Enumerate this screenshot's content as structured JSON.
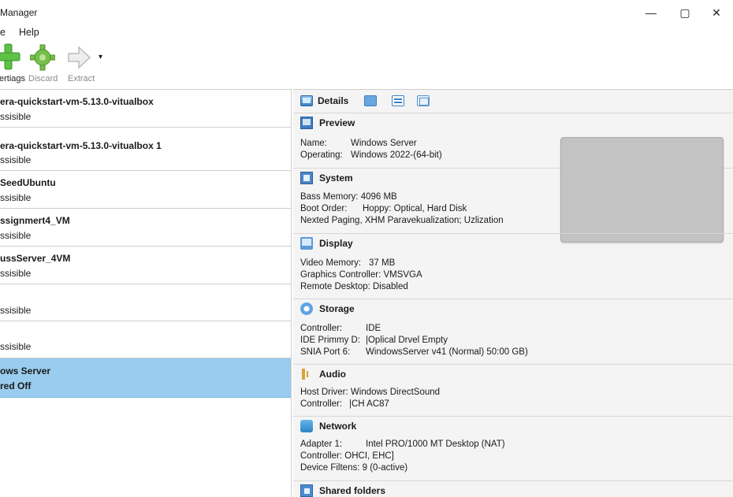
{
  "window": {
    "title": "Manager",
    "controls": {
      "minimize": "—",
      "maximize": "▢",
      "close": "✕"
    }
  },
  "menu": {
    "items": [
      "e",
      "Help"
    ]
  },
  "toolbar": {
    "buttons": [
      {
        "label": "ertiags",
        "icon": "new-icon"
      },
      {
        "label": "Discard",
        "icon": "discard-icon"
      },
      {
        "label": "Extract",
        "icon": "extract-icon"
      }
    ],
    "dropdown_glyph": "▾"
  },
  "vm_list": [
    {
      "name": "era-quickstart-vm-5.13.0-vitualbox",
      "state": "ssisible"
    },
    {
      "name": "era-quickstart-vm-5.13.0-vitualbox 1",
      "state": "ssisible"
    },
    {
      "name": "SeedUbuntu",
      "state": "ssisible"
    },
    {
      "name": "ssignmert4_VM",
      "state": "ssisible"
    },
    {
      "name": "ussServer_4VM",
      "state": "ssisible"
    },
    {
      "name": "",
      "state": "ssisible"
    },
    {
      "name": "",
      "state": "ssisible"
    },
    {
      "name": "ows Server",
      "state": "red Off",
      "selected": true
    }
  ],
  "details": {
    "tab_label": "Details",
    "sections": {
      "preview": {
        "title": "Preview",
        "rows": [
          {
            "k": "Name:",
            "v": "Windows Server"
          },
          {
            "k": "Operating:",
            "v": "Windows 2022-(64-bit)"
          }
        ]
      },
      "system": {
        "title": "System",
        "rows": [
          {
            "k": "Bass Memory:",
            "v": "4096 MB"
          },
          {
            "k": "Boot Order:",
            "v": "Hoppy: Optical, Hard Disk"
          },
          {
            "k": "Nexted Paging,",
            "v": "XHM Paravekualization; Uzlization"
          }
        ]
      },
      "display": {
        "title": "Display",
        "rows": [
          {
            "k": "Video Memory:",
            "v": "37 MB"
          },
          {
            "k": "Graphics Controller:",
            "v": "VMSVGA"
          },
          {
            "k": "Remote Desktop:",
            "v": "Disabled"
          }
        ]
      },
      "storage": {
        "title": "Storage",
        "rows": [
          {
            "k": "Controller:",
            "v": "IDE"
          },
          {
            "k": "IDE Primmy D:",
            "v": "|Oplical Drvel Empty"
          },
          {
            "k": "SNIA Port 6:",
            "v": "WindowsServer v41  (Normal) 50:00 GB)"
          }
        ]
      },
      "audio": {
        "title": "Audio",
        "rows": [
          {
            "k": "Host Driver:",
            "v": "Windows DirectSound"
          },
          {
            "k": "Controller:",
            "v": "|CH AC87"
          }
        ]
      },
      "network": {
        "title": "Network",
        "rows": [
          {
            "k": "Adapter 1:",
            "v": "Intel PRO/1000 MT Desktop (NAT)"
          },
          {
            "k": "Controller:",
            "v": "OHCI, EHC]"
          },
          {
            "k": "Device Filtens:",
            "v": "9 (0-active)"
          }
        ]
      },
      "shared": {
        "title": "Shared folders"
      }
    }
  }
}
